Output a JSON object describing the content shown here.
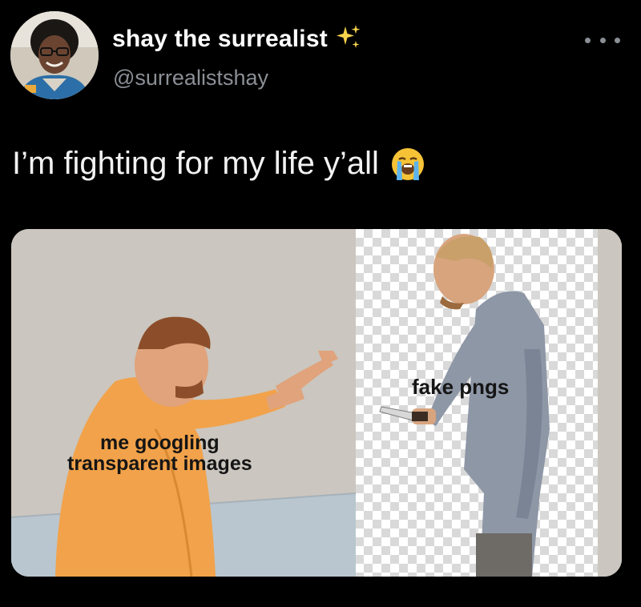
{
  "user": {
    "display_name": "shay the surrealist",
    "name_emoji_icon": "sparkles-icon",
    "handle": "@surrealistshay"
  },
  "menu": {
    "icon": "more-horizontal-icon"
  },
  "tweet": {
    "text": "I’m fighting for my life y’all",
    "emoji_icon": "loudly-crying-face-icon"
  },
  "meme": {
    "caption_left_line1": "me googling",
    "caption_left_line2": "transparent images",
    "caption_right": "fake pngs"
  },
  "colors": {
    "background": "#000000",
    "handle_gray": "#8b8f96",
    "shirt_orange": "#f2a24a",
    "jacket_gray": "#8e97a6"
  }
}
